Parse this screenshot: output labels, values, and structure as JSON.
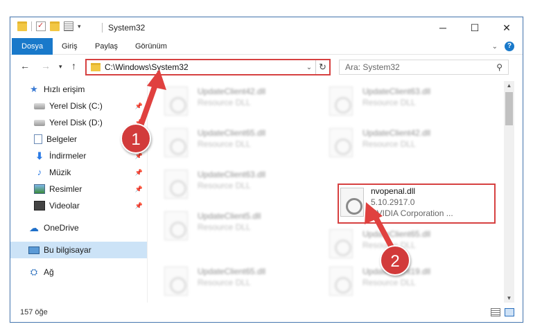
{
  "window": {
    "title": "System32"
  },
  "ribbon": {
    "tabs": [
      "Dosya",
      "Giriş",
      "Paylaş",
      "Görünüm"
    ]
  },
  "address": {
    "path": "C:\\Windows\\System32",
    "search_placeholder": "Ara: System32"
  },
  "sidebar": {
    "items": [
      {
        "label": "Hızlı erişim",
        "icon": "star-icon"
      },
      {
        "label": "Yerel Disk (C:)",
        "icon": "disk-icon"
      },
      {
        "label": "Yerel Disk (D:)",
        "icon": "disk-icon"
      },
      {
        "label": "Belgeler",
        "icon": "document-icon"
      },
      {
        "label": "İndirmeler",
        "icon": "download-icon"
      },
      {
        "label": "Müzik",
        "icon": "music-icon"
      },
      {
        "label": "Resimler",
        "icon": "pictures-icon"
      },
      {
        "label": "Videolar",
        "icon": "video-icon"
      },
      {
        "label": "OneDrive",
        "icon": "cloud-icon"
      },
      {
        "label": "Bu bilgisayar",
        "icon": "computer-icon"
      },
      {
        "label": "Ağ",
        "icon": "network-icon"
      }
    ]
  },
  "files": [
    {
      "name": "UpdateClient42.dll",
      "sub": "Resource DLL"
    },
    {
      "name": "UpdateClient63.dll",
      "sub": "Resource DLL"
    },
    {
      "name": "UpdateClient65.dll",
      "sub": "Resource DLL"
    },
    {
      "name": "UpdateClient42.dll",
      "sub": "Resource DLL"
    },
    {
      "name": "UpdateClient63.dll",
      "sub": "Resource DLL"
    },
    {
      "name": "nvopenal.dll",
      "sub": "5.10.2917.0",
      "sub2": "NVIDIA Corporation ..."
    },
    {
      "name": "UpdateClient5.dll",
      "sub": "Resource DLL"
    },
    {
      "name": "UpdateClient65.dll",
      "sub": "Resource DLL"
    },
    {
      "name": "UpdateClient65.dll",
      "sub": "Resource DLL"
    },
    {
      "name": "UpdateClient19.dll",
      "sub": "Resource DLL"
    }
  ],
  "status": {
    "count": "157 öğe"
  },
  "callouts": [
    "1",
    "2"
  ],
  "colors": {
    "accent": "#1979ca",
    "highlight": "#d64040",
    "callout": "#d23b3b"
  }
}
